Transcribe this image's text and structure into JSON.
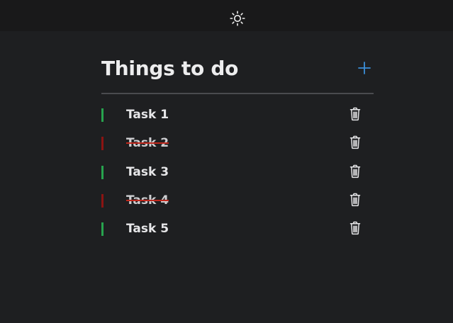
{
  "header": {
    "theme_toggle_icon": "sun-icon"
  },
  "todo": {
    "title": "Things to do",
    "add_icon": "plus-icon",
    "accent_color": "#3b8fd9",
    "tasks": [
      {
        "label": "Task 1",
        "completed": false
      },
      {
        "label": "Task 2",
        "completed": true
      },
      {
        "label": "Task 3",
        "completed": false
      },
      {
        "label": "Task 4",
        "completed": true
      },
      {
        "label": "Task 5",
        "completed": false
      }
    ],
    "delete_icon": "trash-icon"
  },
  "colors": {
    "background": "#1e1f21",
    "topbar": "#19191a",
    "active_status": "#27a34e",
    "done_status": "#8b1412",
    "strike": "#c0281d"
  }
}
